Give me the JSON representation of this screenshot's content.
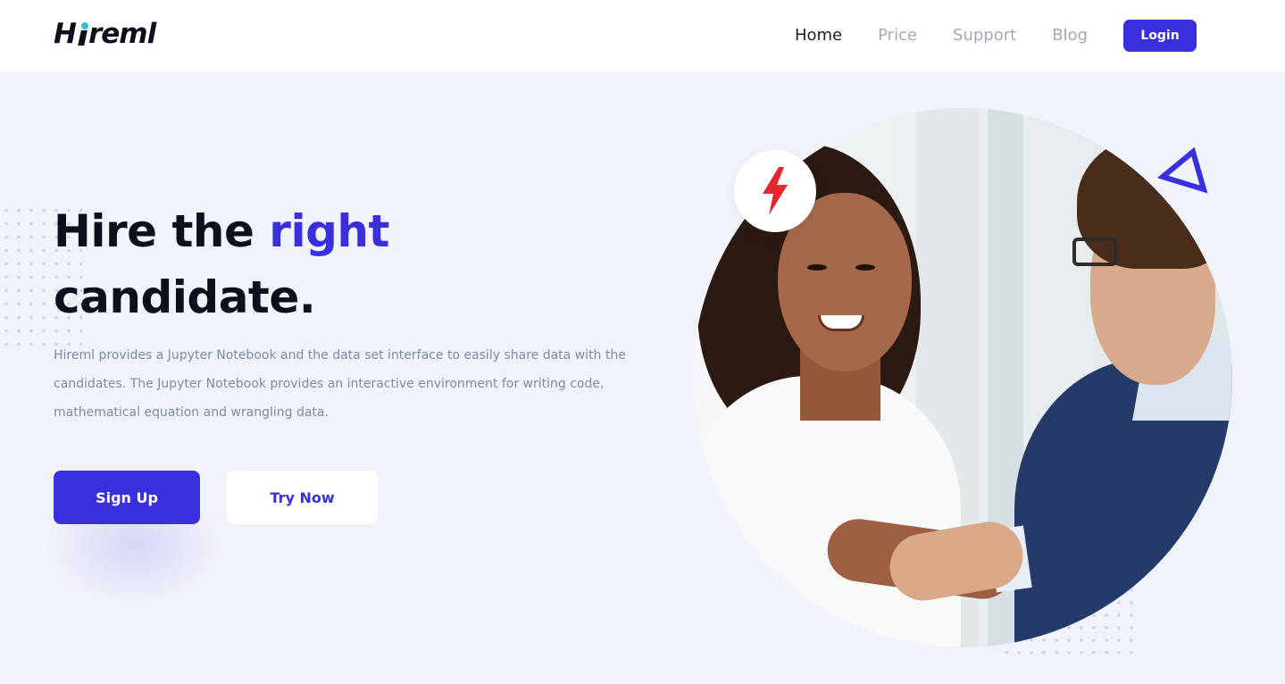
{
  "brand": {
    "logo_text_before_i": "H",
    "logo_text_after_i": "reml",
    "accent_color": "#3a2fdc",
    "logo_dot_color": "#2ec1d6"
  },
  "nav": {
    "items": [
      {
        "label": "Home",
        "active": true
      },
      {
        "label": "Price",
        "active": false
      },
      {
        "label": "Support",
        "active": false
      },
      {
        "label": "Blog",
        "active": false
      }
    ],
    "login_label": "Login"
  },
  "hero": {
    "headline_part1": "Hire the ",
    "headline_accent": "right",
    "headline_part2": "candidate.",
    "description": "Hireml provides a Jupyter Notebook and the data set interface to easily share data with the candidates. The Jupyter Notebook provides an interactive environment for writing code, mathematical equation and wrangling data.",
    "signup_label": "Sign Up",
    "try_label": "Try Now"
  },
  "icons": {
    "badge_icon": "lightning-bolt-icon",
    "decor_icon": "triangle-outline-icon",
    "bolt_color": "#e8242c"
  }
}
